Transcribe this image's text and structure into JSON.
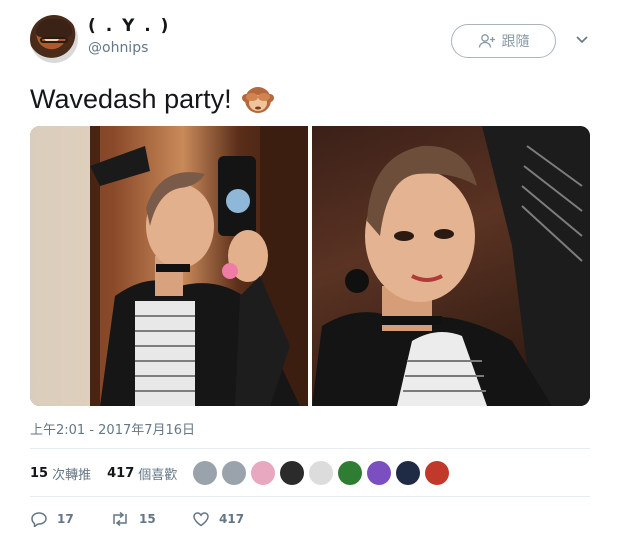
{
  "user": {
    "display_name": "( . Y . )",
    "handle": "@ohnips"
  },
  "follow_button": {
    "label": "跟隨",
    "icon": "person-plus-icon"
  },
  "menu_icon": "chevron-down-icon",
  "tweet": {
    "text": "Wavedash party!",
    "emoji": "see-no-evil-monkey"
  },
  "media": [
    {
      "kind": "photo",
      "description_icon": "photo-mirror-selfie"
    },
    {
      "kind": "photo",
      "description_icon": "photo-selfie"
    }
  ],
  "timestamp": "上午2:01 - 2017年7月16日",
  "stats": {
    "retweets_count": "15",
    "retweets_label": "次轉推",
    "likes_count": "417",
    "likes_label": "個喜歡"
  },
  "likers": [
    {
      "color": "#9aa3ab"
    },
    {
      "color": "#9aa3ab"
    },
    {
      "color": "#e8a8c0"
    },
    {
      "color": "#2b2b2b"
    },
    {
      "color": "#dcdcdc"
    },
    {
      "color": "#2e7d32"
    },
    {
      "color": "#7b4fbf"
    },
    {
      "color": "#1f2a44"
    },
    {
      "color": "#c0392b"
    }
  ],
  "actions": {
    "reply_count": "17",
    "retweet_count": "15",
    "like_count": "417"
  },
  "colors": {
    "secondary_text": "#657786",
    "border": "#e6ecf0"
  }
}
